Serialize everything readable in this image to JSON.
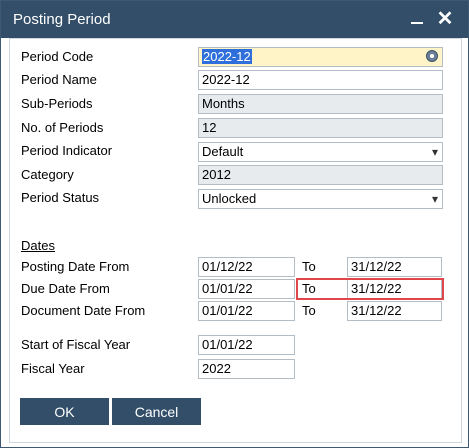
{
  "window": {
    "title": "Posting Period"
  },
  "general": {
    "period_code_label": "Period Code",
    "period_code_value": "2022-12",
    "period_name_label": "Period Name",
    "period_name_value": "2022-12",
    "sub_periods_label": "Sub-Periods",
    "sub_periods_value": "Months",
    "no_of_periods_label": "No. of Periods",
    "no_of_periods_value": "12",
    "period_indicator_label": "Period Indicator",
    "period_indicator_value": "Default",
    "category_label": "Category",
    "category_value": "2012",
    "period_status_label": "Period Status",
    "period_status_value": "Unlocked"
  },
  "dates": {
    "section_label": "Dates",
    "to_label": "To",
    "rows": [
      {
        "label": "Posting Date From",
        "from": "01/12/22",
        "to": "31/12/22"
      },
      {
        "label": "Due Date From",
        "from": "01/01/22",
        "to": "31/12/22"
      },
      {
        "label": "Document Date From",
        "from": "01/01/22",
        "to": "31/12/22"
      }
    ]
  },
  "fiscal": {
    "start_label": "Start of Fiscal Year",
    "start_value": "01/01/22",
    "year_label": "Fiscal Year",
    "year_value": "2022"
  },
  "buttons": {
    "ok": "OK",
    "cancel": "Cancel"
  },
  "colors": {
    "title_bar": "#324e68",
    "highlight_border": "#e0464a",
    "selected_text": "#2f6fdb"
  }
}
